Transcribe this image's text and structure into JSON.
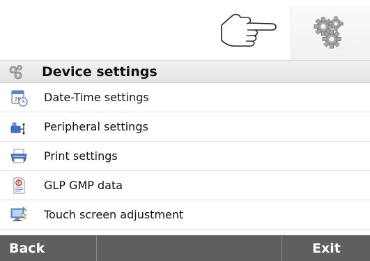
{
  "toolbar": {
    "hand_icon": "pointing-hand-icon",
    "gear_icon": "gears-icon"
  },
  "header": {
    "icon": "gears-icon",
    "title": "Device settings"
  },
  "menu": {
    "items": [
      {
        "label": "Date-Time settings",
        "icon": "calendar-clock-icon"
      },
      {
        "label": "Peripheral settings",
        "icon": "peripheral-device-icon"
      },
      {
        "label": "Print settings",
        "icon": "printer-icon"
      },
      {
        "label": "GLP GMP data",
        "icon": "glp-document-icon"
      },
      {
        "label": "Touch screen adjustment",
        "icon": "touch-screen-icon"
      }
    ]
  },
  "footer": {
    "back_label": "Back",
    "exit_label": "Exit"
  },
  "colors": {
    "footer_bg": "#5f5f5f",
    "header_bg": "#e9e9e9",
    "text": "#111111"
  }
}
